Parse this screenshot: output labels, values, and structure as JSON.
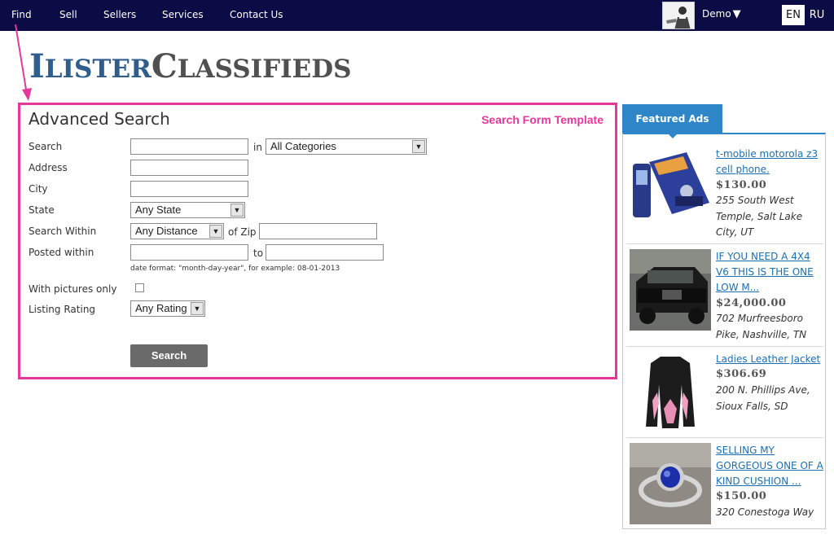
{
  "nav": {
    "items": [
      "Find",
      "Sell",
      "Sellers",
      "Services",
      "Contact Us"
    ],
    "user_label": "Demo",
    "languages": [
      "EN",
      "RU"
    ]
  },
  "logo": {
    "part1_big": "I",
    "part1_small": "LISTER",
    "part2_big": "C",
    "part2_small": "LASSIFIEDS"
  },
  "search_form": {
    "title": "Advanced Search",
    "template_label": "Search Form Template",
    "search_label": "Search",
    "in_label": "in",
    "category_selected": "All Categories",
    "address_label": "Address",
    "city_label": "City",
    "state_label": "State",
    "state_selected": "Any State",
    "search_within_label": "Search Within",
    "distance_selected": "Any Distance",
    "of_zip_label": "of Zip",
    "posted_within_label": "Posted within",
    "to_label": "to",
    "date_hint": "date format: \"month-day-year\", for example: 08-01-2013",
    "pictures_label": "With pictures only",
    "rating_label": "Listing Rating",
    "rating_selected": "Any Rating",
    "search_button": "Search"
  },
  "featured": {
    "tab_label": "Featured Ads",
    "ads": [
      {
        "title": "t-mobile motorola z3 cell phone.",
        "price": "$130.00",
        "address": "255 South West Temple, Salt Lake City, UT",
        "image_icon": "cell-phone-image"
      },
      {
        "title": "IF YOU NEED A 4X4 V6 THIS IS THE ONE LOW M...",
        "price": "$24,000.00",
        "address": "702 Murfreesboro Pike, Nashville, TN",
        "image_icon": "jeep-image"
      },
      {
        "title": "Ladies Leather Jacket",
        "price": "$306.69",
        "address": "200 N. Phillips Ave, Sioux Falls, SD",
        "image_icon": "jacket-image"
      },
      {
        "title": "SELLING MY GORGEOUS ONE OF A KIND CUSHION ...",
        "price": "$150.00",
        "address": "320 Conestoga Way",
        "image_icon": "ring-image"
      }
    ]
  },
  "colors": {
    "nav_bg": "#0b0b45",
    "annotation": "#e8379b",
    "featured_tab": "#2e86c9",
    "link": "#1a6fb5"
  }
}
